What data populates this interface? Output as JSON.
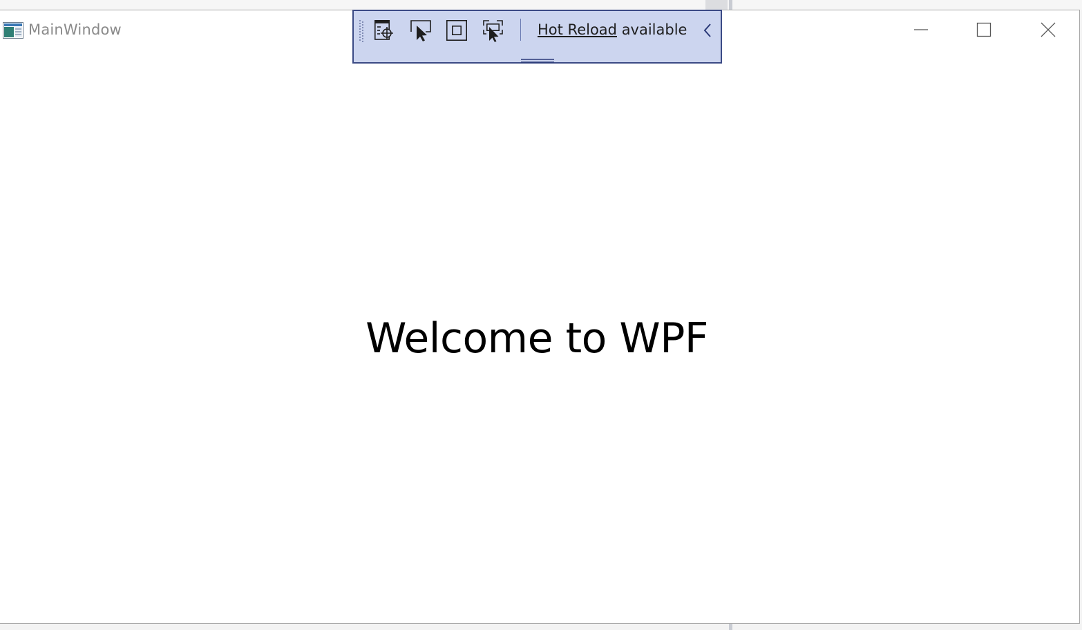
{
  "window": {
    "title": "MainWindow",
    "content_text": "Welcome to WPF"
  },
  "hot_reload_toolbar": {
    "link_text": "Hot Reload",
    "status_text": "available",
    "buttons": [
      {
        "icon": "go-to-live-visual-tree-icon"
      },
      {
        "icon": "select-element-icon"
      },
      {
        "icon": "display-layout-adorners-icon"
      },
      {
        "icon": "track-focused-element-icon"
      }
    ],
    "background_color": "#ccd5ef",
    "border_color": "#3b4a85"
  },
  "caption_buttons": {
    "minimize": "minimize-icon",
    "maximize": "maximize-icon",
    "close": "close-icon"
  }
}
